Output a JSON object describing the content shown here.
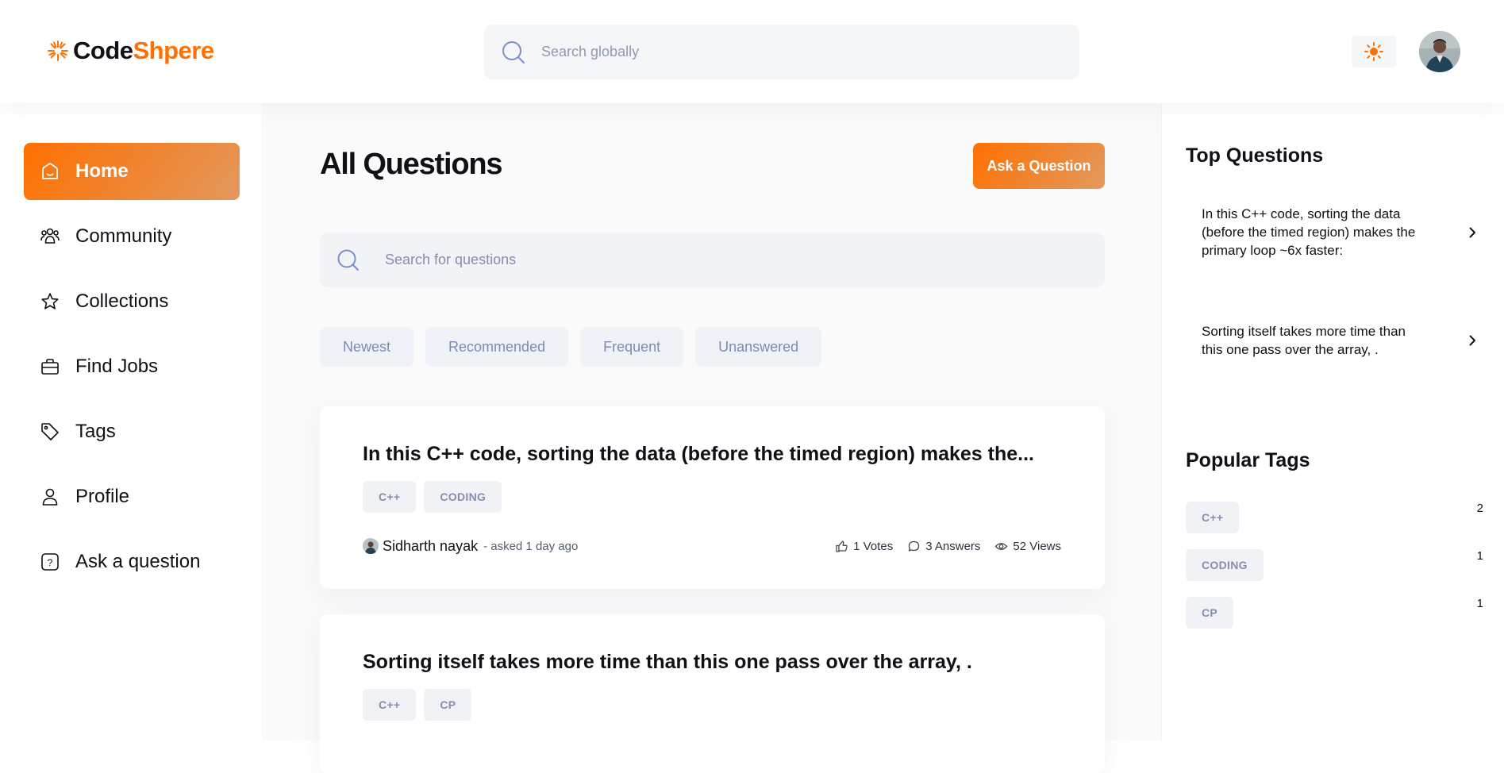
{
  "brand": {
    "name_part1": "Code",
    "name_part2": "Shpere",
    "accent": "#ff7000"
  },
  "header": {
    "search_placeholder": "Search globally",
    "theme_icon": "sun-icon",
    "avatar_icon": "user-avatar"
  },
  "sidebar": {
    "items": [
      {
        "label": "Home",
        "icon": "home-icon",
        "active": true
      },
      {
        "label": "Community",
        "icon": "users-icon",
        "active": false
      },
      {
        "label": "Collections",
        "icon": "star-icon",
        "active": false
      },
      {
        "label": "Find Jobs",
        "icon": "briefcase-icon",
        "active": false
      },
      {
        "label": "Tags",
        "icon": "tag-icon",
        "active": false
      },
      {
        "label": "Profile",
        "icon": "user-icon",
        "active": false
      },
      {
        "label": "Ask a question",
        "icon": "question-icon",
        "active": false
      }
    ]
  },
  "main": {
    "title": "All Questions",
    "ask_button": "Ask a Question",
    "search_placeholder": "Search for questions",
    "filters": [
      "Newest",
      "Recommended",
      "Frequent",
      "Unanswered"
    ],
    "questions": [
      {
        "title": "In this C++ code, sorting the data (before the timed region) makes the...",
        "tags": [
          "C++",
          "CODING"
        ],
        "author": "Sidharth nayak",
        "asked": "- asked 1 day ago",
        "votes": "1 Votes",
        "answers": "3 Answers",
        "views": "52 Views"
      },
      {
        "title": "Sorting itself takes more time than this one pass over the array, .",
        "tags": [
          "C++",
          "CP"
        ]
      }
    ]
  },
  "right_sidebar": {
    "top_questions_title": "Top Questions",
    "top_questions": [
      "In this C++ code, sorting the data (before the timed region) makes the primary loop ~6x faster:",
      "Sorting itself takes more time than this one pass over the array, ."
    ],
    "popular_tags_title": "Popular Tags",
    "popular_tags": [
      {
        "name": "C++",
        "count": "2"
      },
      {
        "name": "CODING",
        "count": "1"
      },
      {
        "name": "CP",
        "count": "1"
      }
    ]
  }
}
